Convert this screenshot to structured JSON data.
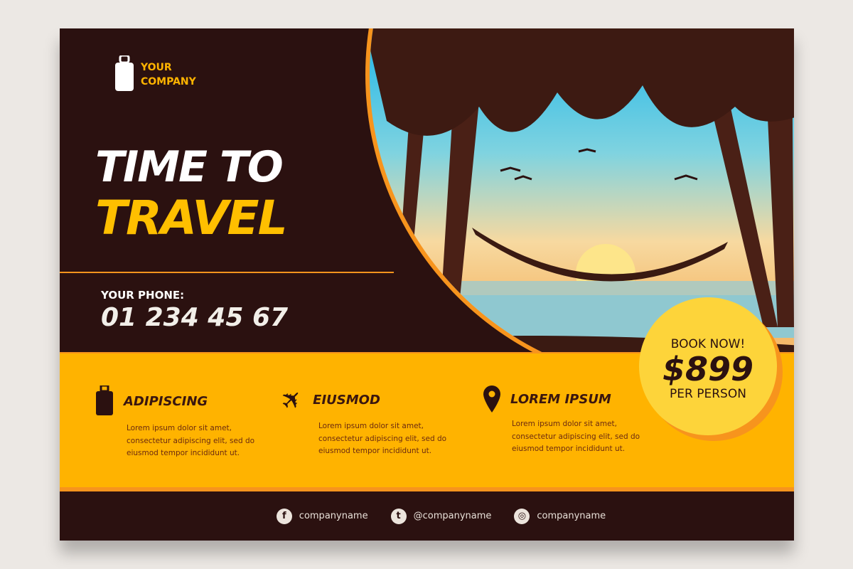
{
  "logo": {
    "line1": "YOUR",
    "line2": "COMPANY"
  },
  "headline": {
    "line1": "TIME TO",
    "line2": "TRAVEL"
  },
  "phone": {
    "label": "YOUR PHONE:",
    "number": "01 234 45 67"
  },
  "features": [
    {
      "icon": "suitcase-icon",
      "title": "ADIPISCING",
      "text": [
        "Lorem ipsum dolor sit amet,",
        "consectetur adipiscing elit, sed do",
        "eiusmod tempor incididunt ut."
      ]
    },
    {
      "icon": "airplane-icon",
      "title": "EIUSMOD",
      "text": [
        "Lorem ipsum dolor sit amet,",
        "consectetur adipiscing elit, sed do",
        "eiusmod tempor incididunt ut."
      ]
    },
    {
      "icon": "location-pin-icon",
      "title": "LOREM IPSUM",
      "text": [
        "Lorem ipsum dolor sit amet,",
        "consectetur adipiscing elit, sed do",
        "eiusmod tempor incididunt ut."
      ]
    }
  ],
  "offer": {
    "cta": "BOOK NOW!",
    "price": "$899",
    "unit": "PER PERSON"
  },
  "social": [
    {
      "icon": "facebook-icon",
      "glyph": "f",
      "handle": "companyname"
    },
    {
      "icon": "twitter-icon",
      "glyph": "t",
      "handle": "@companyname"
    },
    {
      "icon": "instagram-icon",
      "glyph": "◎",
      "handle": "companyname"
    }
  ],
  "colors": {
    "dark": "#2b1110",
    "yellow": "#ffb300",
    "orange": "#f7941d",
    "light_yellow": "#fdd43a"
  }
}
